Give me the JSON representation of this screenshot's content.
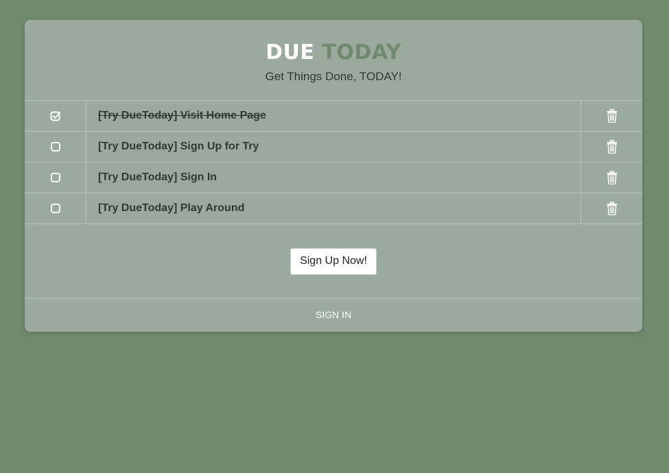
{
  "header": {
    "title_part1": "DUE",
    "title_part2": "TODAY",
    "subtitle": "Get Things Done, TODAY!"
  },
  "colors": {
    "background": "#708a6f",
    "card": "#9aaa9c",
    "accent": "#708a6f"
  },
  "todos": [
    {
      "text": "[Try DueToday] Visit Home Page",
      "done": true
    },
    {
      "text": "[Try DueToday] Sign Up for Try",
      "done": false
    },
    {
      "text": "[Try DueToday] Sign In",
      "done": false
    },
    {
      "text": "[Try DueToday] Play Around",
      "done": false
    }
  ],
  "icons": {
    "checked": "checkbox-checked-icon",
    "unchecked": "checkbox-unchecked-icon",
    "delete": "trash-icon"
  },
  "cta": {
    "label": "Sign Up Now!"
  },
  "footer": {
    "signin_label": "SIGN IN"
  }
}
